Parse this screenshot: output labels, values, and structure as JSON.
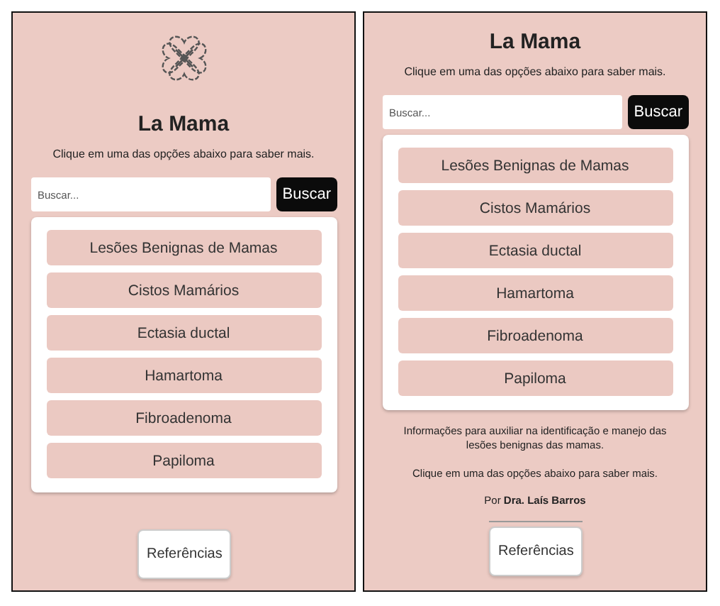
{
  "screens": [
    {
      "show_logo": true,
      "title": "La Mama",
      "subtitle": "Clique em uma das opções abaixo para saber mais.",
      "search": {
        "placeholder": "Buscar...",
        "button": "Buscar"
      },
      "items": [
        "Lesões Benignas de Mamas",
        "Cistos Mamários",
        "Ectasia ductal",
        "Hamartoma",
        "Fibroadenoma",
        "Papiloma"
      ],
      "references": "Referências"
    },
    {
      "show_logo": false,
      "title": "La Mama",
      "subtitle": "Clique em uma das opções abaixo para saber mais.",
      "search": {
        "placeholder": "Buscar...",
        "button": "Buscar"
      },
      "items": [
        "Lesões Benignas de Mamas",
        "Cistos Mamários",
        "Ectasia ductal",
        "Hamartoma",
        "Fibroadenoma",
        "Papiloma"
      ],
      "footer": {
        "info": "Informações para auxiliar na identificação e manejo das lesões benignas das mamas.",
        "subtitle": "Clique em uma das opções abaixo para saber mais.",
        "byline": "Por **Dra. Laís Barros**"
      },
      "references": "Referências"
    }
  ]
}
